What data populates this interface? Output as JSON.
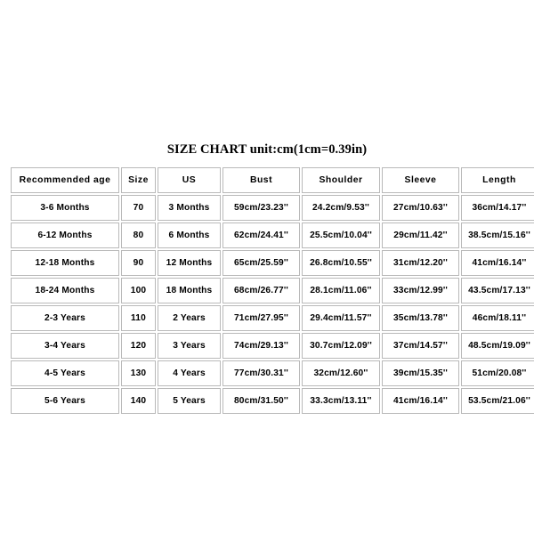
{
  "title": "SIZE CHART unit:cm(1cm=0.39in)",
  "table": {
    "headers": [
      "Recommended age",
      "Size",
      "US",
      "Bust",
      "Shoulder",
      "Sleeve",
      "Length"
    ],
    "rows": [
      [
        "3-6 Months",
        "70",
        "3 Months",
        "59cm/23.23''",
        "24.2cm/9.53''",
        "27cm/10.63''",
        "36cm/14.17''"
      ],
      [
        "6-12 Months",
        "80",
        "6 Months",
        "62cm/24.41''",
        "25.5cm/10.04''",
        "29cm/11.42''",
        "38.5cm/15.16''"
      ],
      [
        "12-18 Months",
        "90",
        "12 Months",
        "65cm/25.59''",
        "26.8cm/10.55''",
        "31cm/12.20''",
        "41cm/16.14''"
      ],
      [
        "18-24 Months",
        "100",
        "18 Months",
        "68cm/26.77''",
        "28.1cm/11.06''",
        "33cm/12.99''",
        "43.5cm/17.13''"
      ],
      [
        "2-3 Years",
        "110",
        "2 Years",
        "71cm/27.95''",
        "29.4cm/11.57''",
        "35cm/13.78''",
        "46cm/18.11''"
      ],
      [
        "3-4 Years",
        "120",
        "3 Years",
        "74cm/29.13''",
        "30.7cm/12.09''",
        "37cm/14.57''",
        "48.5cm/19.09''"
      ],
      [
        "4-5 Years",
        "130",
        "4 Years",
        "77cm/30.31''",
        "32cm/12.60''",
        "39cm/15.35''",
        "51cm/20.08''"
      ],
      [
        "5-6 Years",
        "140",
        "5 Years",
        "80cm/31.50''",
        "33.3cm/13.11''",
        "41cm/16.14''",
        "53.5cm/21.06''"
      ]
    ]
  },
  "colors": {
    "background": "#ffffff",
    "text": "#000000",
    "border": "#b9b9b9"
  }
}
